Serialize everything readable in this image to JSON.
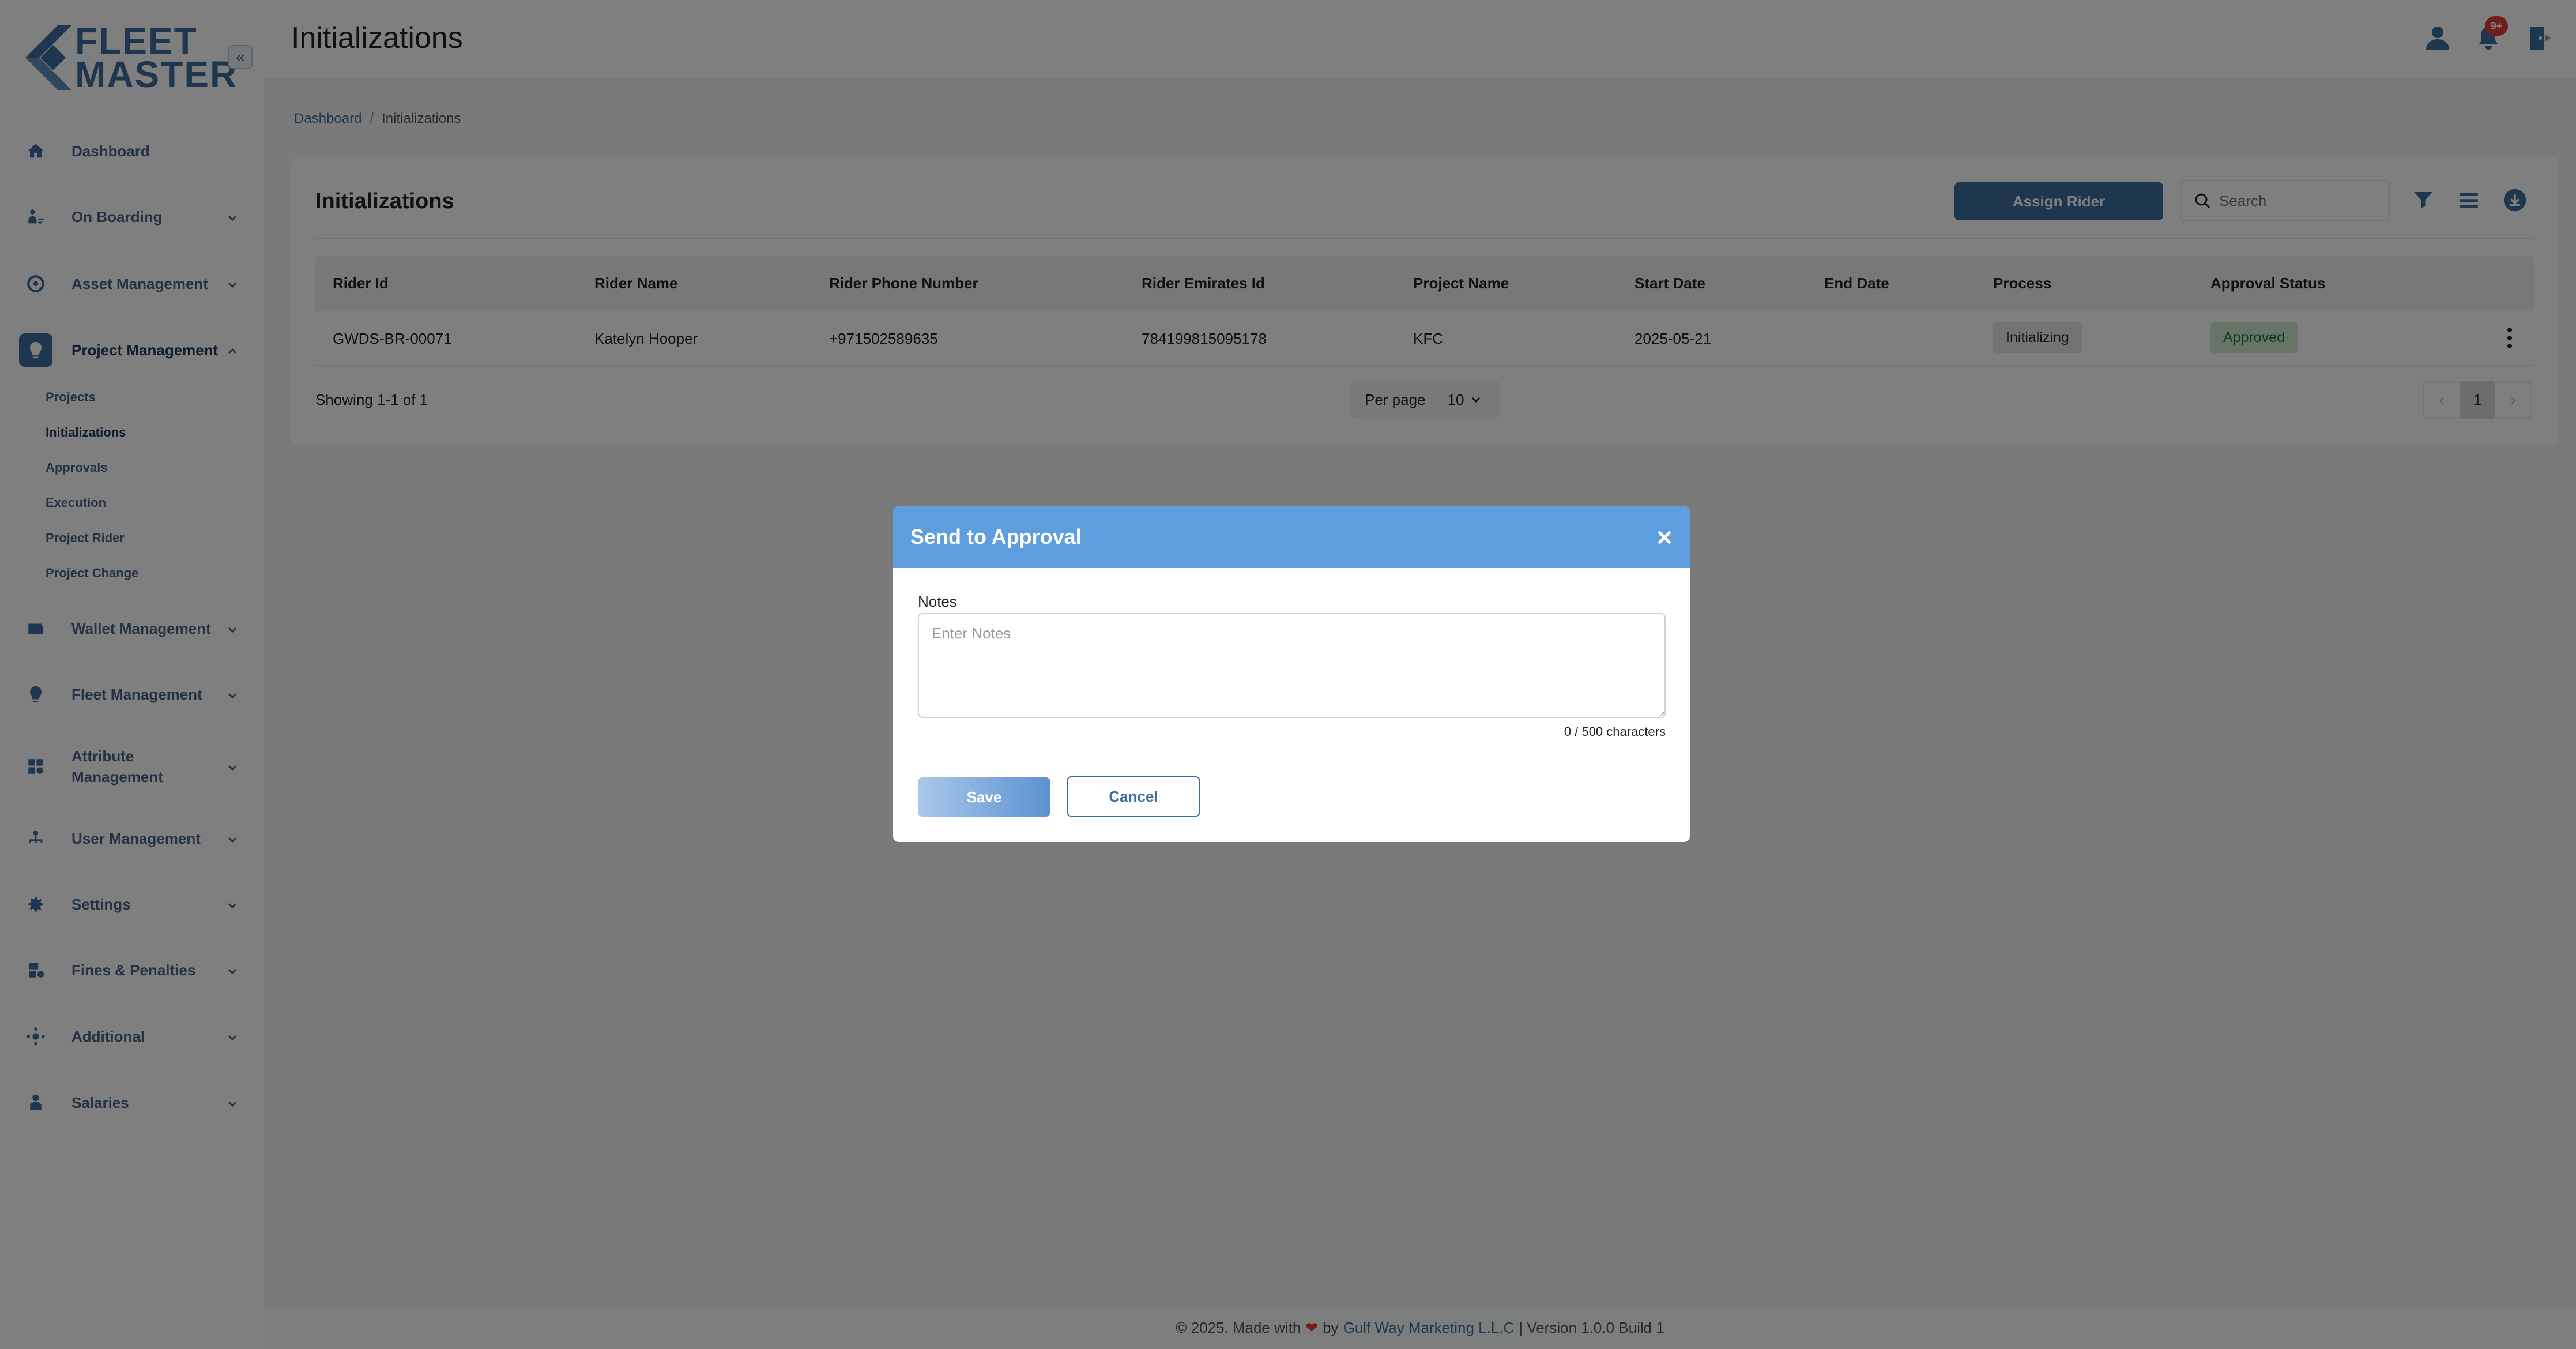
{
  "brand": {
    "line1": "FLEET",
    "line2": "MASTER",
    "collapse_icon": "double-chevron-left-icon"
  },
  "header": {
    "title": "Initializations",
    "notification_badge": "9+"
  },
  "breadcrumb": {
    "items": [
      "Dashboard",
      "Initializations"
    ]
  },
  "sidebar": {
    "items": [
      {
        "label": "Dashboard",
        "icon": "home-icon"
      },
      {
        "label": "On Boarding",
        "icon": "onboarding-icon"
      },
      {
        "label": "Asset Management",
        "icon": "asset-icon"
      },
      {
        "label": "Project Management",
        "icon": "project-icon",
        "expanded": true,
        "sub_items": [
          "Projects",
          "Initializations",
          "Approvals",
          "Execution",
          "Project Rider",
          "Project Change"
        ]
      },
      {
        "label": "Wallet Management",
        "icon": "wallet-icon"
      },
      {
        "label": "Fleet Management",
        "icon": "fleet-icon"
      },
      {
        "label": "Attribute",
        "label_line2": "Management",
        "icon": "attribute-icon"
      },
      {
        "label": "User Management",
        "icon": "users-icon"
      },
      {
        "label": "Settings",
        "icon": "gear-icon"
      },
      {
        "label": "Fines & Penalties",
        "icon": "fines-icon"
      },
      {
        "label": "Additional",
        "icon": "additional-icon"
      },
      {
        "label": "Salaries",
        "icon": "salaries-icon"
      }
    ],
    "active_sub_item": "Initializations"
  },
  "card": {
    "title": "Initializations",
    "assign_button": "Assign Rider",
    "search_placeholder": "Search",
    "columns": [
      "Rider Id",
      "Rider Name",
      "Rider Phone Number",
      "Rider Emirates Id",
      "Project Name",
      "Start Date",
      "End Date",
      "Process",
      "Approval Status"
    ],
    "rows": [
      {
        "rider_id": "GWDS-BR-00071",
        "rider_name": "Katelyn Hooper",
        "phone": "+971502589635",
        "emirates_id": "784199815095178",
        "project": "KFC",
        "start_date": "2025-05-21",
        "end_date": "",
        "process": "Initializing",
        "status": "Approved"
      }
    ],
    "showing": "Showing 1-1 of 1",
    "per_page_label": "Per page",
    "per_page_value": "10",
    "current_page": "1"
  },
  "footer": {
    "prefix": "© 2025. Made with",
    "by": "by",
    "company": "Gulf Way Marketing L.L.C",
    "suffix": "| Version 1.0.0 Build 1"
  },
  "modal": {
    "title": "Send to Approval",
    "notes_label": "Notes",
    "notes_placeholder": "Enter Notes",
    "notes_value": "",
    "char_count": "0 / 500 characters",
    "save_label": "Save",
    "cancel_label": "Cancel"
  },
  "colors": {
    "primary": "#3d6e9d",
    "modal_header": "#5e9edf",
    "badge": "#e33b3b",
    "approved_bg": "#cfe8cf"
  }
}
